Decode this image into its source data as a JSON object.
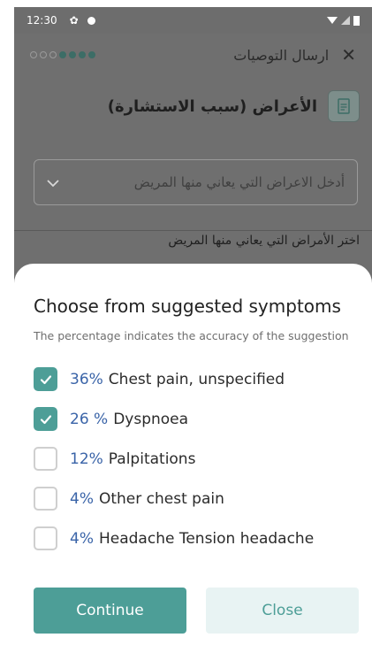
{
  "status_bar": {
    "time": "12:30"
  },
  "background_app": {
    "stepper": {
      "total_steps": 7,
      "completed_steps": 4
    },
    "header_title": "ارسال التوصيات",
    "section_title": "الأعراض (سبب الاستشارة)",
    "symptom_select_placeholder": "أدخل الاعراض التي يعاني منها المريض",
    "choose_symptoms_label": "اختر الأمراض التي يعاني منها المريض"
  },
  "sheet": {
    "title": "Choose from suggested symptoms",
    "subtitle": "The percentage indicates the accuracy of the suggestion",
    "options": [
      {
        "percent": "36%",
        "label": "Chest pain, unspecified",
        "checked": true
      },
      {
        "percent": "26 %",
        "label": "Dyspnoea",
        "checked": true
      },
      {
        "percent": "12%",
        "label": "Palpitations",
        "checked": false
      },
      {
        "percent": "4%",
        "label": "Other chest pain",
        "checked": false
      },
      {
        "percent": "4%",
        "label": "Headache Tension headache",
        "checked": false
      }
    ],
    "continue_label": "Continue",
    "close_label": "Close"
  },
  "colors": {
    "accent": "#4d9e97",
    "percent_text": "#3a64a8",
    "overlay": "#6f6f6f"
  }
}
